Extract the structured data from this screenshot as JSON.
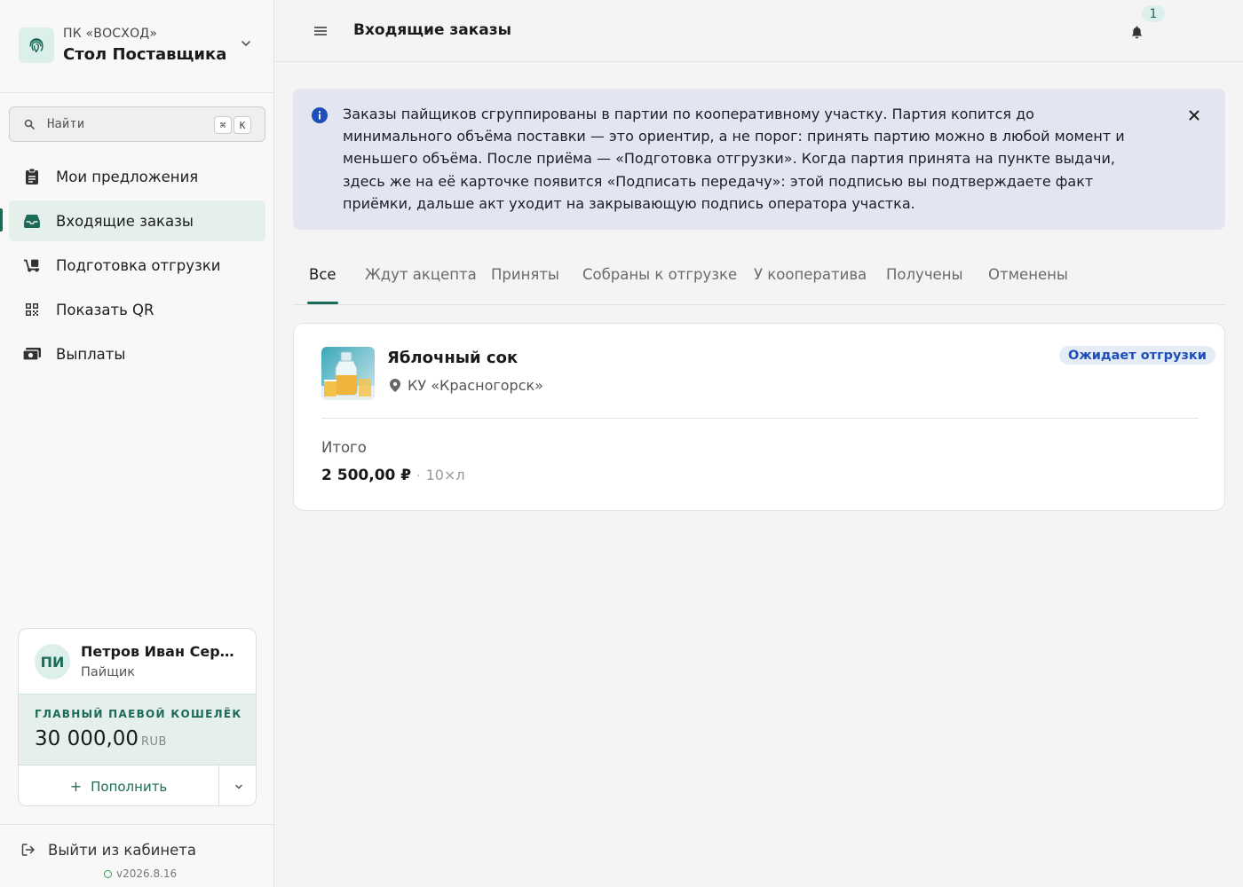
{
  "org": {
    "subtitle": "ПК «ВОСХОД»",
    "name": "Стол Поставщика"
  },
  "search": {
    "placeholder": "Найти",
    "shortcut_mod": "⌘",
    "shortcut_key": "K"
  },
  "nav": {
    "items": [
      {
        "label": "Мои предложения",
        "icon": "clipboard-icon",
        "active": false
      },
      {
        "label": "Входящие заказы",
        "icon": "inbox-icon",
        "active": true
      },
      {
        "label": "Подготовка отгрузки",
        "icon": "dolly-icon",
        "active": false
      },
      {
        "label": "Показать QR",
        "icon": "qr-code-icon",
        "active": false
      },
      {
        "label": "Выплаты",
        "icon": "money-icon",
        "active": false
      }
    ]
  },
  "user": {
    "initials": "ПИ",
    "name": "Петров Иван Сергеевич",
    "role": "Пайщик",
    "wallet_title": "ГЛАВНЫЙ ПАЕВОЙ КОШЕЛЁК",
    "wallet_amount": "30 000,00",
    "wallet_currency": "RUB",
    "topup_label": "Пополнить"
  },
  "footer": {
    "logout_label": "Выйти из кабинета",
    "version": "v2026.8.16"
  },
  "header": {
    "title": "Входящие заказы",
    "notification_count": "1"
  },
  "info_banner": {
    "text": "Заказы пайщиков сгруппированы в партии по кооперативному участку. Партия копится до минимального объёма поставки — это ориентир, а не порог: принять партию можно в любой момент и меньшего объёма. После приёма — «Подготовка отгрузки». Когда партия принята на пункте выдачи, здесь же на её карточке появится «Подписать передачу»: этой подписью вы подтверждаете факт приёмки, дальше акт уходит на закрывающую подпись оператора участка."
  },
  "tabs": [
    {
      "label": "Все",
      "active": true
    },
    {
      "label": "Ждут акцепта",
      "active": false
    },
    {
      "label": "Приняты",
      "active": false
    },
    {
      "label": "Собраны к отгрузке",
      "active": false
    },
    {
      "label": "У кооператива",
      "active": false
    },
    {
      "label": "Получены",
      "active": false
    },
    {
      "label": "Отменены",
      "active": false
    }
  ],
  "order": {
    "product": "Яблочный сок",
    "location": "КУ «Красногорск»",
    "status": "Ожидает отгрузки",
    "total_label": "Итого",
    "total_amount": "2 500,00 ₽",
    "separator": "·",
    "quantity": "10×л"
  },
  "colors": {
    "accent": "#1c6a58",
    "accent_light": "#e5efec",
    "info_bg": "#e3e6f0",
    "info_icon": "#1d4fb8",
    "status_text": "#1d4fb8",
    "status_bg": "#e6ecf6"
  }
}
